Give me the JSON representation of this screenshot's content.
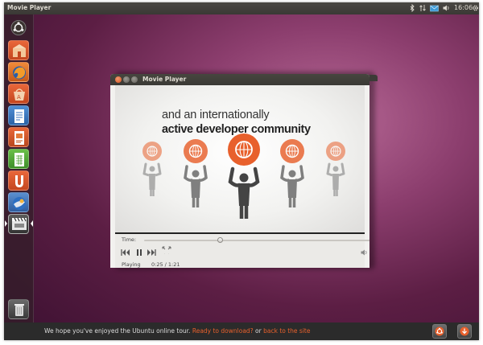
{
  "top_panel": {
    "app_title": "Movie Player",
    "clock": "16:06",
    "tray_icons": [
      "bluetooth-icon",
      "network-icon",
      "mail-icon",
      "volume-icon",
      "clock",
      "gear-icon"
    ]
  },
  "launcher": {
    "items": [
      {
        "name": "ubuntu-logo-icon"
      },
      {
        "name": "home-folder-icon"
      },
      {
        "name": "firefox-icon"
      },
      {
        "name": "software-center-icon"
      },
      {
        "name": "writer-icon"
      },
      {
        "name": "impress-icon"
      },
      {
        "name": "calc-icon"
      },
      {
        "name": "ubuntu-one-icon"
      },
      {
        "name": "thunderbird-icon"
      },
      {
        "name": "movie-player-icon",
        "active": true
      }
    ],
    "trash": "trash-icon"
  },
  "window": {
    "title": "Movie Player",
    "buttons": [
      "close-icon",
      "minimize-icon",
      "maximize-icon"
    ]
  },
  "video": {
    "line1": "and an internationally",
    "line2": "active developer community"
  },
  "controls": {
    "time_label": "Time:",
    "progress": 0.33,
    "status": "Playing",
    "timecode": "0:25 / 1:21"
  },
  "bottom": {
    "text_before": "We hope you've enjoyed the Ubuntu online tour. ",
    "download_link": "Ready to download?",
    "text_or": " or ",
    "site_link": "back to the site"
  },
  "colors": {
    "accent": "#e8602c",
    "panel": "#3c3b37",
    "desktop": "#8c3e6e"
  }
}
